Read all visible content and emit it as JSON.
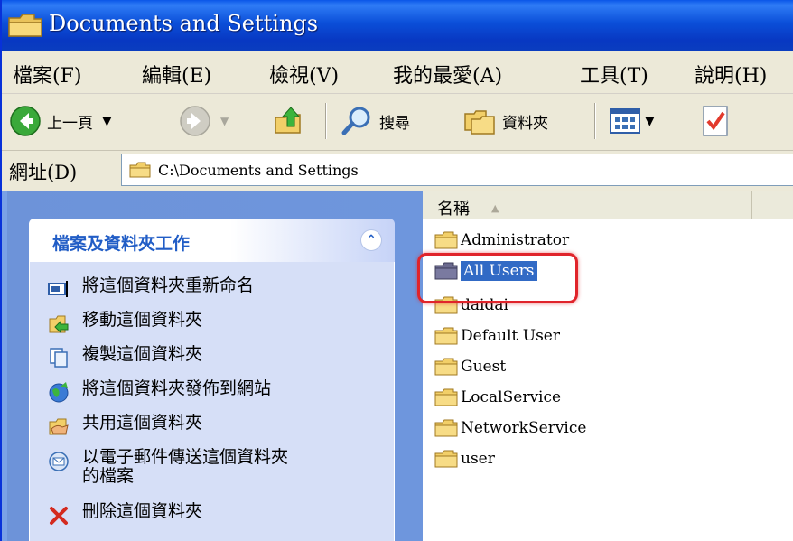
{
  "window": {
    "title": "Documents and Settings",
    "title_icon": "folder-icon"
  },
  "menu": [
    {
      "label": "檔案(F)"
    },
    {
      "label": "編輯(E)"
    },
    {
      "label": "檢視(V)"
    },
    {
      "label": "我的最愛(A)"
    },
    {
      "label": "工具(T)"
    },
    {
      "label": "說明(H)"
    }
  ],
  "toolbar": {
    "back_label": "上一頁",
    "search_label": "搜尋",
    "folders_label": "資料夾"
  },
  "address": {
    "label": "網址(D)",
    "value": "C:\\Documents and Settings"
  },
  "tasks": {
    "title": "檔案及資料夾工作",
    "collapse_glyph": "⌃",
    "items": [
      {
        "label": "將這個資料夾重新命名",
        "icon": "rename-icon"
      },
      {
        "label": "移動這個資料夾",
        "icon": "move-icon"
      },
      {
        "label": "複製這個資料夾",
        "icon": "copy-icon"
      },
      {
        "label": "將這個資料夾發佈到網站",
        "icon": "publish-web-icon"
      },
      {
        "label": "共用這個資料夾",
        "icon": "share-icon"
      },
      {
        "label": "以電子郵件傳送這個資料夾\n的檔案",
        "icon": "email-icon"
      },
      {
        "label": "刪除這個資料夾",
        "icon": "delete-icon"
      }
    ]
  },
  "files": {
    "column_name": "名稱",
    "sort_glyph": "▲",
    "selected": "All Users",
    "items": [
      {
        "name": "Administrator"
      },
      {
        "name": "All Users"
      },
      {
        "name": "daidai"
      },
      {
        "name": "Default User"
      },
      {
        "name": "Guest"
      },
      {
        "name": "LocalService"
      },
      {
        "name": "NetworkService"
      },
      {
        "name": "user"
      }
    ]
  },
  "colors": {
    "titlebar": "#0a4fd8",
    "menubar": "#ece9d8",
    "taskpane": "#6e96dd",
    "selection": "#316ac5",
    "highlight": "#e0242b"
  }
}
